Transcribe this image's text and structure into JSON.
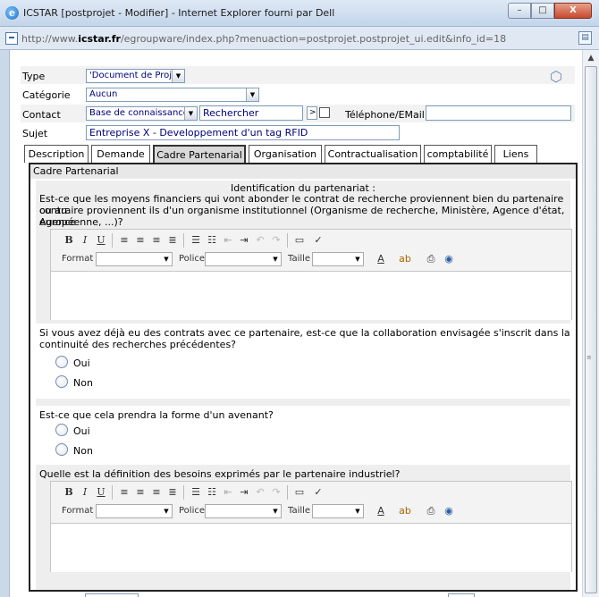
{
  "window": {
    "title": "ICSTAR [postprojet - Modifier] - Internet Explorer fourni par Dell",
    "controls": {
      "minimize": "–",
      "maximize": "□",
      "close": "X"
    }
  },
  "address": {
    "url_prefix": "http://www.",
    "url_domain": "icstar.fr",
    "url_rest": "/egroupware/index.php?menuaction=postprojet.postprojet_ui.edit&info_id=18"
  },
  "form": {
    "type_label": "Type",
    "type_value": "'Document de Projet'",
    "category_label": "Catégorie",
    "category_value": "Aucun",
    "contact_label": "Contact",
    "contact_source": "Base de connaissances",
    "contact_search": "Rechercher",
    "contact_go": ">",
    "phone_label": "Téléphone/EMail",
    "phone_value": "",
    "subject_label": "Sujet",
    "subject_value": "Entreprise X - Developpement d'un tag RFID"
  },
  "tabs": [
    {
      "label": "Description"
    },
    {
      "label": "Demande"
    },
    {
      "label": "Cadre Partenarial",
      "active": true
    },
    {
      "label": "Organisation"
    },
    {
      "label": "Contractualisation"
    },
    {
      "label": "comptabilité"
    },
    {
      "label": "Liens"
    }
  ],
  "panel": {
    "title": "Cadre Partenarial",
    "section_header": "Identification du partenariat :",
    "q1_line1": "Est-ce que les moyens financiers qui vont abonder le contrat de recherche proviennent bien du partenaire ou au",
    "q1_line2": "contraire proviennent ils d'un organisme institutionnel (Organisme de recherche, Ministère, Agence d'état, Agence",
    "q1_line3": "européenne, ...)?",
    "q2_line1": "Si vous avez déjà eu des contrats avec ce partenaire, est-ce que la collaboration envisagée s'inscrit dans la",
    "q2_line2": "continuité des recherches précédentes?",
    "q3": "Est-ce que cela prendra la forme d'un avenant?",
    "q4": "Quelle est la définition des besoins exprimés par le partenaire industriel?",
    "yes": "Oui",
    "no": "Non"
  },
  "editor": {
    "bold": "B",
    "italic": "I",
    "underline": "U",
    "format_label": "Format",
    "font_label": "Police",
    "size_label": "Taille",
    "font_color": "A",
    "highlight": "ab"
  }
}
